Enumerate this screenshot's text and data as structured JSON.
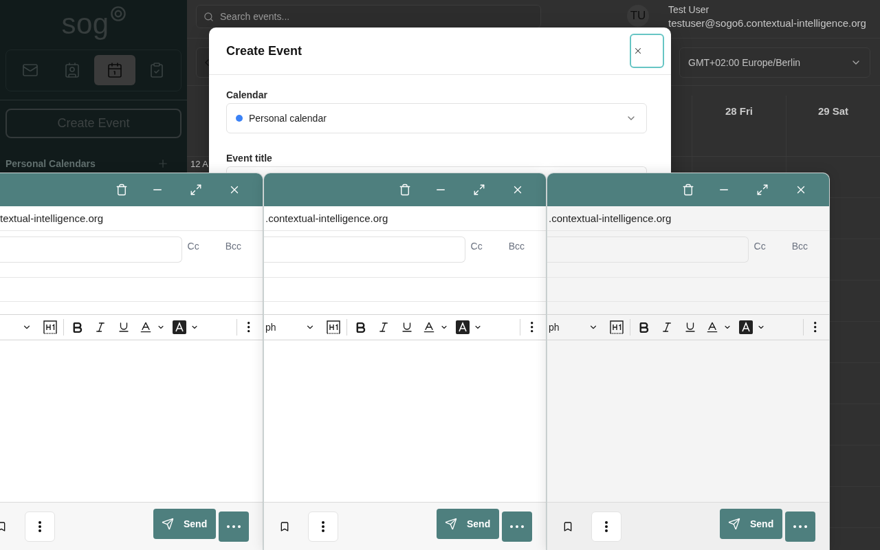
{
  "sidebar": {
    "logo": "sog",
    "nav_tabs": [
      {
        "kind": "mail",
        "selected": false
      },
      {
        "kind": "contacts",
        "selected": false
      },
      {
        "kind": "calendar",
        "selected": true
      },
      {
        "kind": "tasks",
        "selected": false
      }
    ],
    "create_button": "Create Event",
    "section_title": "Personal Calendars"
  },
  "header": {
    "search": {
      "placeholder": "Search events..."
    },
    "avatar": "TU",
    "user_name": "Test User",
    "user_email": "testuser@sogo6.contextual-intelligence.org"
  },
  "toolbar": {
    "timezone": "GMT+02:00 Europe/Berlin"
  },
  "calendar": {
    "days": [
      "28 Fri",
      "29 Sat"
    ],
    "time_label": "12 A"
  },
  "modal": {
    "title": "Create Event",
    "fields": [
      {
        "kind": "select",
        "label": "Calendar",
        "value": "Personal calendar",
        "color": "#3b82f6"
      },
      {
        "kind": "text",
        "label": "Event title"
      }
    ]
  },
  "compose_windows": [
    {
      "from": "textual-intelligence.org",
      "cc": "Cc",
      "bcc": "Bcc",
      "send": "Send"
    },
    {
      "from": ".contextual-intelligence.org",
      "format": "ph",
      "cc": "Cc",
      "bcc": "Bcc",
      "send": "Send"
    },
    {
      "from": ".contextual-intelligence.org",
      "format": "ph",
      "cc": "Cc",
      "bcc": "Bcc",
      "send": "Send"
    }
  ]
}
